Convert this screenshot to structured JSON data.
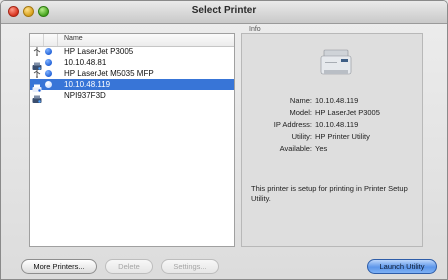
{
  "window": {
    "title": "Select Printer"
  },
  "list": {
    "column_name": "Name",
    "rows": [
      {
        "label": "HP LaserJet P3005",
        "kind_icon": "usb-icon",
        "status_icon": "blue-dot-icon",
        "selected": false
      },
      {
        "label": "10.10.48.81",
        "kind_icon": "network-printer-icon",
        "status_icon": "blue-dot-icon",
        "selected": false
      },
      {
        "label": "HP LaserJet M5035 MFP",
        "kind_icon": "usb-icon",
        "status_icon": "blue-dot-icon",
        "selected": false
      },
      {
        "label": "10.10.48.119",
        "kind_icon": "network-printer-icon",
        "status_icon": "blue-dot-icon",
        "selected": true
      },
      {
        "label": "NPI937F3D",
        "kind_icon": "network-printer-icon",
        "status_icon": "",
        "selected": false
      }
    ]
  },
  "info": {
    "label": "Info",
    "name_key": "Name:",
    "name_val": "10.10.48.119",
    "model_key": "Model:",
    "model_val": "HP LaserJet P3005",
    "ip_key": "IP Address:",
    "ip_val": "10.10.48.119",
    "utility_key": "Utility:",
    "utility_val": "HP Printer Utility",
    "available_key": "Available:",
    "available_val": "Yes",
    "note": "This printer is setup for printing in Printer Setup Utility."
  },
  "buttons": {
    "more_printers": "More Printers...",
    "delete": "Delete",
    "settings": "Settings...",
    "launch_utility": "Launch Utility"
  },
  "colors": {
    "selection": "#3875d7",
    "primary_button": "#5d97ea"
  }
}
